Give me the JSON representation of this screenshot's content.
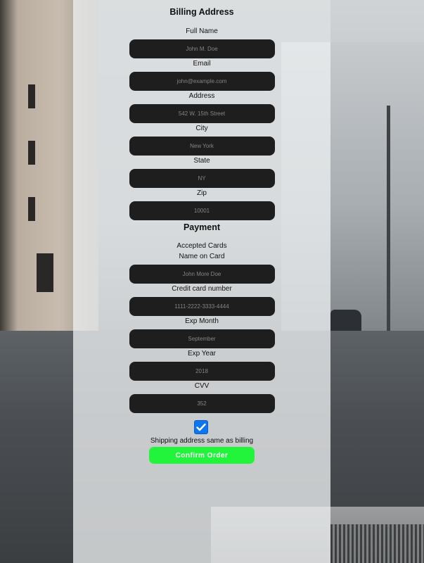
{
  "billing": {
    "title": "Billing Address",
    "full_name": {
      "label": "Full Name",
      "placeholder": "John M. Doe"
    },
    "email": {
      "label": "Email",
      "placeholder": "john@example.com"
    },
    "address": {
      "label": "Address",
      "placeholder": "542 W. 15th Street"
    },
    "city": {
      "label": "City",
      "placeholder": "New York"
    },
    "state": {
      "label": "State",
      "placeholder": "NY"
    },
    "zip": {
      "label": "Zip",
      "placeholder": "10001"
    }
  },
  "payment": {
    "title": "Payment",
    "accepted_cards_label": "Accepted Cards",
    "name_on_card": {
      "label": "Name on Card",
      "placeholder": "John More Doe"
    },
    "card_number": {
      "label": "Credit card number",
      "placeholder": "1111-2222-3333-4444"
    },
    "exp_month": {
      "label": "Exp Month",
      "placeholder": "September"
    },
    "exp_year": {
      "label": "Exp Year",
      "placeholder": "2018"
    },
    "cvv": {
      "label": "CVV",
      "placeholder": "352"
    }
  },
  "shipping_same": {
    "label": "Shipping address same as billing",
    "checked": true
  },
  "confirm_button": {
    "label": "Confirm Order"
  },
  "colors": {
    "panel": "#eceef0",
    "field_bg": "#1e1e1e",
    "checkbox": "#0b76ef",
    "confirm_button": "#21f43a"
  }
}
